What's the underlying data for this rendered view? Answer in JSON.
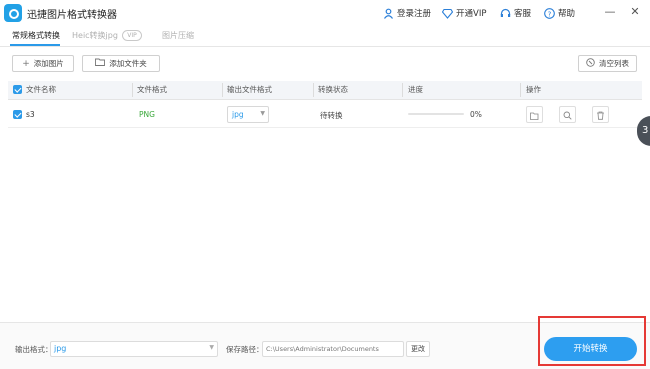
{
  "app": {
    "title": "迅捷图片格式转换器"
  },
  "titlebar": {
    "login_label": "登录注册",
    "vip_label": "开通VIP",
    "service_label": "客服",
    "help_label": "帮助",
    "minimize": "—",
    "close": "✕"
  },
  "tabs": [
    {
      "label": "常规格式转换",
      "active": true
    },
    {
      "label": "Heic转换jpg",
      "active": false,
      "badge": "VIP"
    },
    {
      "label": "图片压缩",
      "active": false
    }
  ],
  "toolbar": {
    "add_image_label": "添加图片",
    "add_folder_label": "添加文件夹",
    "clear_list_label": "清空列表"
  },
  "table": {
    "headers": [
      "文件名称",
      "文件格式",
      "输出文件格式",
      "转换状态",
      "进度",
      "操作"
    ],
    "rows": [
      {
        "name": "s3",
        "format": "PNG",
        "output_format": "jpg",
        "status": "待转换",
        "progress_text": "0%",
        "progress": 0.0
      }
    ]
  },
  "side_handle": {
    "label": "3"
  },
  "bottom": {
    "output_format_label": "输出格式：",
    "output_format_value": "jpg",
    "save_path_label": "保存路径：",
    "save_path_value": "C:\\Users\\Administrator\\Documents",
    "change_label": "更改",
    "start_label": "开始转换"
  },
  "colors": {
    "accent": "#2b9ae9",
    "png_green": "#3aa83a",
    "highlight_red": "#e53935"
  }
}
